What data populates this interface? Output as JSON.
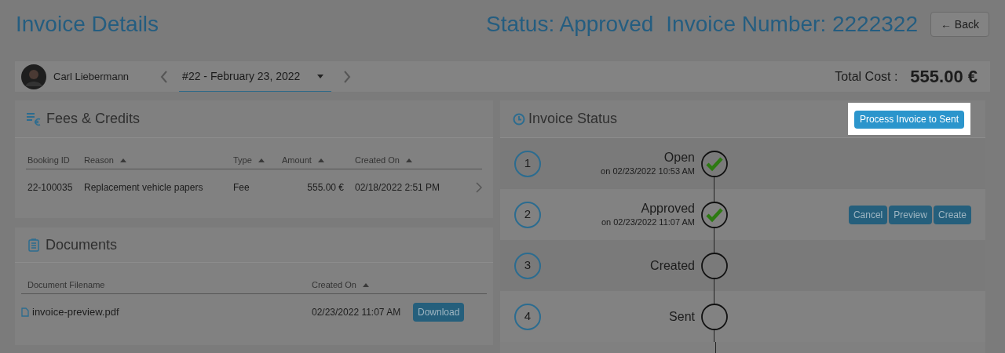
{
  "header": {
    "title": "Invoice Details",
    "status": "Status: Approved",
    "invoice_number": "Invoice Number: 2222322",
    "back_button": "← Back"
  },
  "toolbar": {
    "customer": "Carl Liebermann",
    "invoice_select": "#22 - February 23, 2022",
    "total_label": "Total Cost :",
    "total_value": "555.00 €"
  },
  "fees": {
    "title": "Fees & Credits",
    "columns": [
      {
        "label": "Booking ID",
        "sortable": false
      },
      {
        "label": "Reason",
        "sortable": true
      },
      {
        "label": "Type",
        "sortable": true
      },
      {
        "label": "Amount",
        "sortable": true
      },
      {
        "label": "Created On",
        "sortable": true
      }
    ],
    "rows": [
      [
        "22-100035",
        "Replacement vehicle papers",
        "Fee",
        "555.00 €",
        "02/18/2022 2:51 PM"
      ]
    ]
  },
  "documents": {
    "title": "Documents",
    "columns": [
      {
        "label": "Document Filename",
        "sortable": false
      },
      {
        "label": "Created On",
        "sortable": true
      }
    ],
    "rows": [
      {
        "filename": "invoice-preview.pdf",
        "created_on": "02/23/2022 11:07 AM",
        "action": "Download"
      }
    ]
  },
  "invoice_status": {
    "title": "Invoice Status",
    "process_button": "Process Invoice to Sent",
    "steps": [
      {
        "number": "1",
        "label": "Open",
        "date": "on 02/23/2022 10:53 AM",
        "completed": true
      },
      {
        "number": "2",
        "label": "Approved",
        "date": "on 02/23/2022 11:07 AM",
        "completed": true,
        "actions": [
          "Cancel",
          "Preview",
          "Create"
        ]
      },
      {
        "number": "3",
        "label": "Created",
        "completed": false
      },
      {
        "number": "4",
        "label": "Sent",
        "completed": false
      }
    ]
  }
}
